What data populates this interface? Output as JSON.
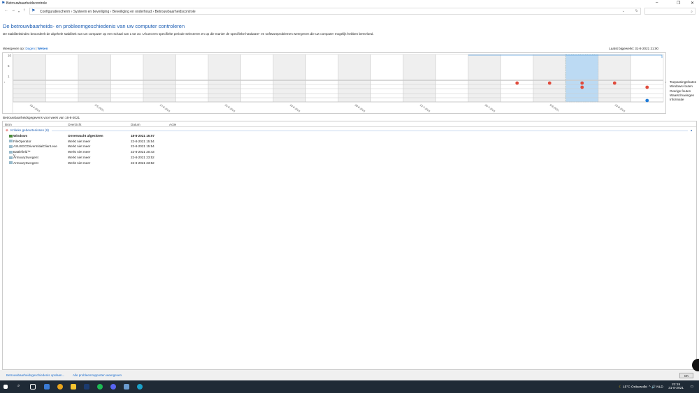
{
  "window": {
    "title": "Betrouwbaarheidscontrole"
  },
  "breadcrumb": [
    "Configuratiescherm",
    "Systeem en beveiliging",
    "Beveiliging en onderhoud",
    "Betrouwbaarheidscontrole"
  ],
  "heading": "De betrouwbaarheids- en probleemgeschiedenis van uw computer controleren",
  "description": "De stabiliteitsindex beoordeelt de algehele stabiliteit van uw computer op een schaal van 1 tot 10. U kunt een specifieke periode selecteren en op die manier de specifieke hardware- en softwareproblemen weergeven die uw computer mogelijk hebben beïnvloed.",
  "view": {
    "label": "Weergeven op:",
    "days": "Dagen",
    "sep": "|",
    "weeks": "Weken"
  },
  "last_updated": "Laatst bijgewerkt: 31-8-2021 21:00",
  "chart_data": {
    "type": "timeline",
    "y_ticks": [
      "10",
      "5",
      "1"
    ],
    "x_labels": [
      "19-4-2021",
      "3-5-2021",
      "17-5-2021",
      "31-5-2021",
      "14-6-2021",
      "28-6-2021",
      "12-7-2021",
      "26-7-2021",
      "9-8-2021",
      "23-8-2021"
    ],
    "weeks": 20,
    "selected_week": 17,
    "stability_start_week": 14,
    "stability_value": 10,
    "rows": [
      "Toepassingsfouten",
      "Windows-fouten",
      "Overige fouten",
      "Waarschuwingen",
      "Informatie"
    ],
    "events": [
      {
        "row": 0,
        "weeks": [
          15,
          16,
          17,
          18
        ]
      },
      {
        "row": 1,
        "weeks": [
          17,
          19
        ]
      },
      {
        "row": 4,
        "weeks": [
          19
        ],
        "kind": "info"
      }
    ]
  },
  "details": {
    "title": "Betrouwbaarheidsgegevens voor week van 16-8-2021",
    "columns": [
      "Bron",
      "Overzicht",
      "Datum",
      "Actie"
    ],
    "group": "Kritieke gebeurtenissen (6)",
    "rows": [
      {
        "source": "Windows",
        "summary": "Onverwacht afgesloten",
        "date": "18-8-2021 15:07"
      },
      {
        "source": "FileOperator",
        "summary": "Werkt niet meer",
        "date": "22-8-2021 15:54"
      },
      {
        "source": "ASUSGCDriverInitialClient.exe",
        "summary": "Werkt niet meer",
        "date": "22-8-2021 15:54"
      },
      {
        "source": "Battlefield™ V",
        "summary": "Werkt niet meer",
        "date": "22-8-2021 20:43"
      },
      {
        "source": "ArmourySwAgent",
        "summary": "Werkt niet meer",
        "date": "22-8-2021 23:52"
      },
      {
        "source": "ArmourySwAgent",
        "summary": "Werkt niet meer",
        "date": "22-8-2021 23:52"
      }
    ]
  },
  "footer": {
    "save": "Betrouwbaarheidsgeschiedenis opslaan...",
    "all_reports": "Alle probleemrapporten weergeven",
    "ok": "OK"
  },
  "tray": {
    "weather": "15°C  Onbewolkt",
    "lang": "NLD",
    "time": "22:15",
    "date": "31-8-2021"
  }
}
